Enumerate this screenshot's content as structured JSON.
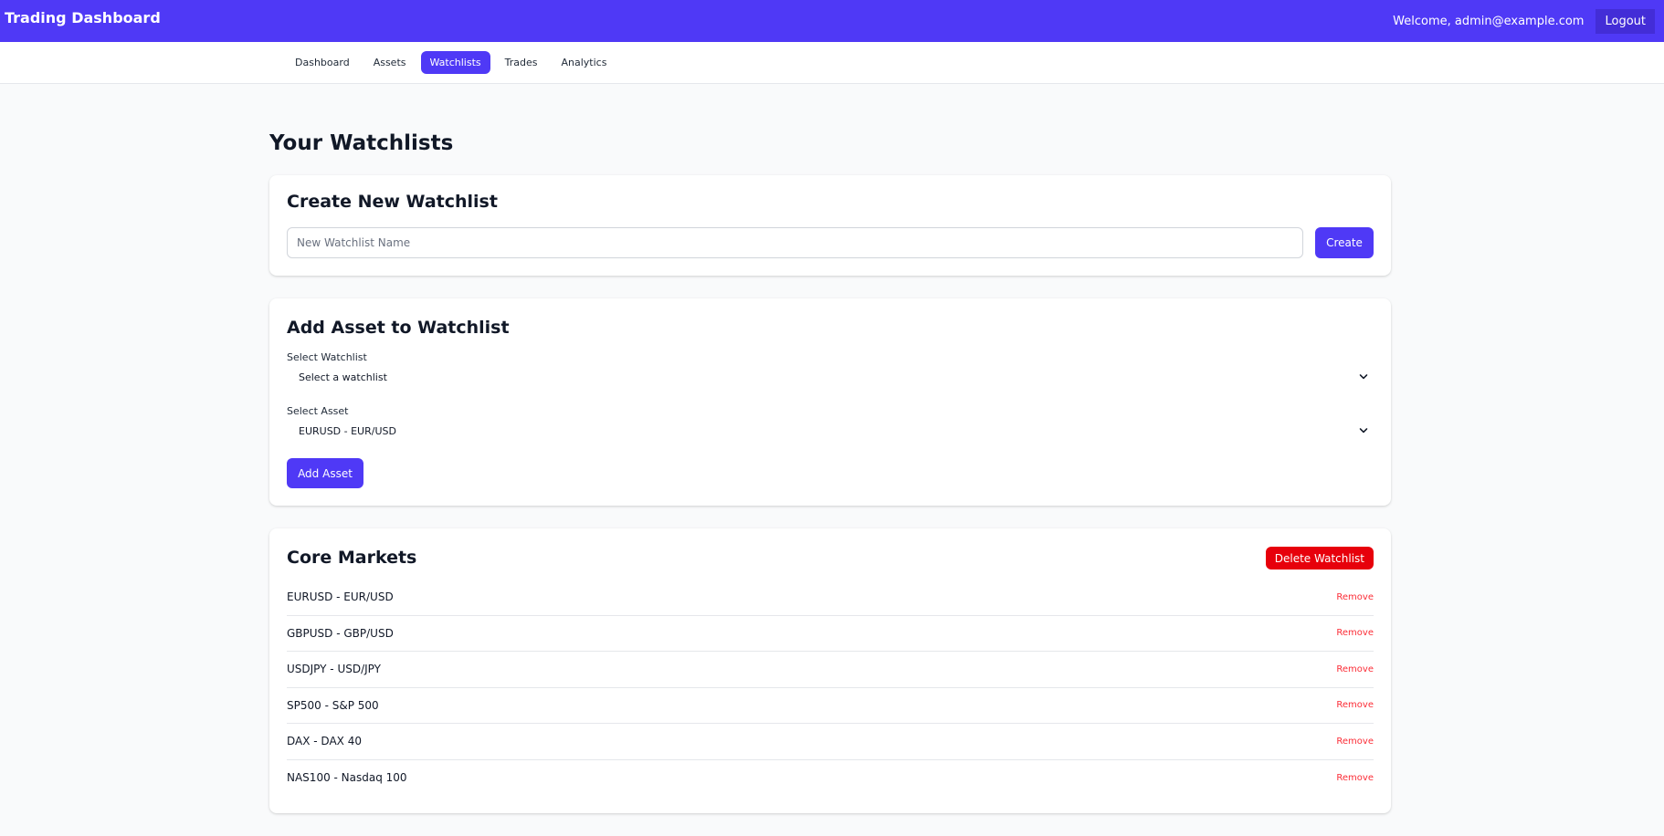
{
  "header": {
    "title": "Trading Dashboard",
    "welcome": "Welcome, admin@example.com",
    "logout_label": "Logout"
  },
  "nav": {
    "tabs": [
      {
        "label": "Dashboard",
        "active": false
      },
      {
        "label": "Assets",
        "active": false
      },
      {
        "label": "Watchlists",
        "active": true
      },
      {
        "label": "Trades",
        "active": false
      },
      {
        "label": "Analytics",
        "active": false
      }
    ]
  },
  "page": {
    "title": "Your Watchlists"
  },
  "create_card": {
    "heading": "Create New Watchlist",
    "input_value": "",
    "input_placeholder": "New Watchlist Name",
    "button_label": "Create"
  },
  "add_card": {
    "heading": "Add Asset to Watchlist",
    "watchlist_label": "Select Watchlist",
    "watchlist_selected": "Select a watchlist",
    "asset_label": "Select Asset",
    "asset_selected": "EURUSD - EUR/USD",
    "button_label": "Add Asset"
  },
  "watchlist": {
    "name": "Core Markets",
    "delete_label": "Delete Watchlist",
    "remove_label": "Remove",
    "assets": [
      "EURUSD - EUR/USD",
      "GBPUSD - GBP/USD",
      "USDJPY - USD/JPY",
      "SP500 - S&P 500",
      "DAX - DAX 40",
      "NAS100 - Nasdaq 100"
    ]
  },
  "colors": {
    "brand": "#4f39f6",
    "brand_dark": "#432dd7",
    "danger": "#e7000b",
    "remove_text": "#fb2c36"
  },
  "icons": {
    "select_chevron": "chevron-down-icon"
  }
}
